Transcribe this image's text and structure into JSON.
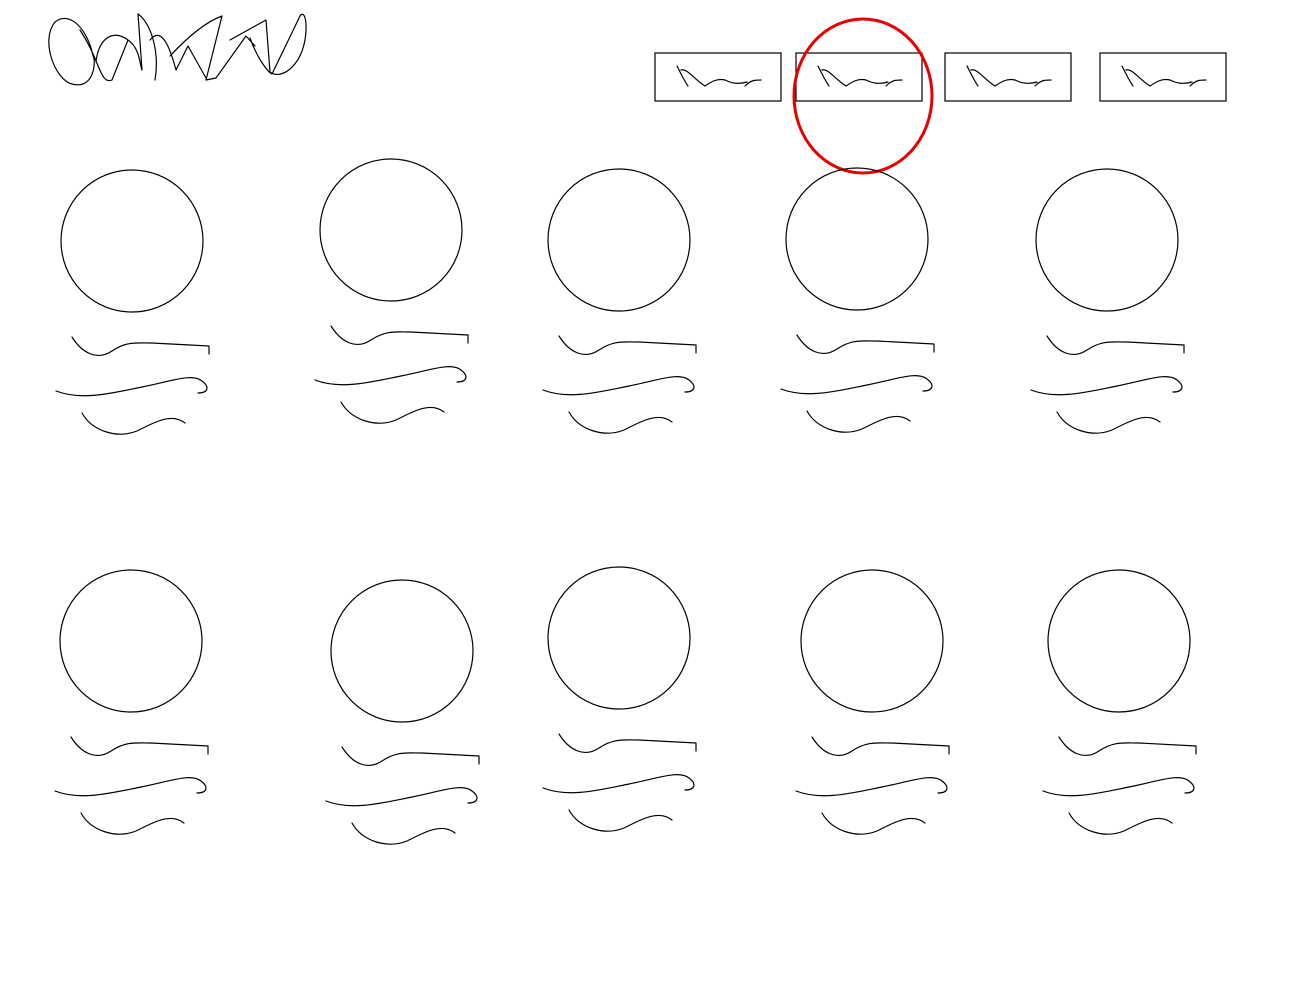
{
  "header": {
    "logo_icon": "scribble-logo-icon"
  },
  "tabs": {
    "count": 4,
    "selected_index": 1,
    "icon": "squiggle-icon"
  },
  "grid": {
    "rows": 2,
    "columns": 5,
    "card_icon": "circle-avatar-icon",
    "card_text_lines": 3
  },
  "colors": {
    "ink": "#000000",
    "background": "#ffffff",
    "highlight": "#e60000"
  }
}
